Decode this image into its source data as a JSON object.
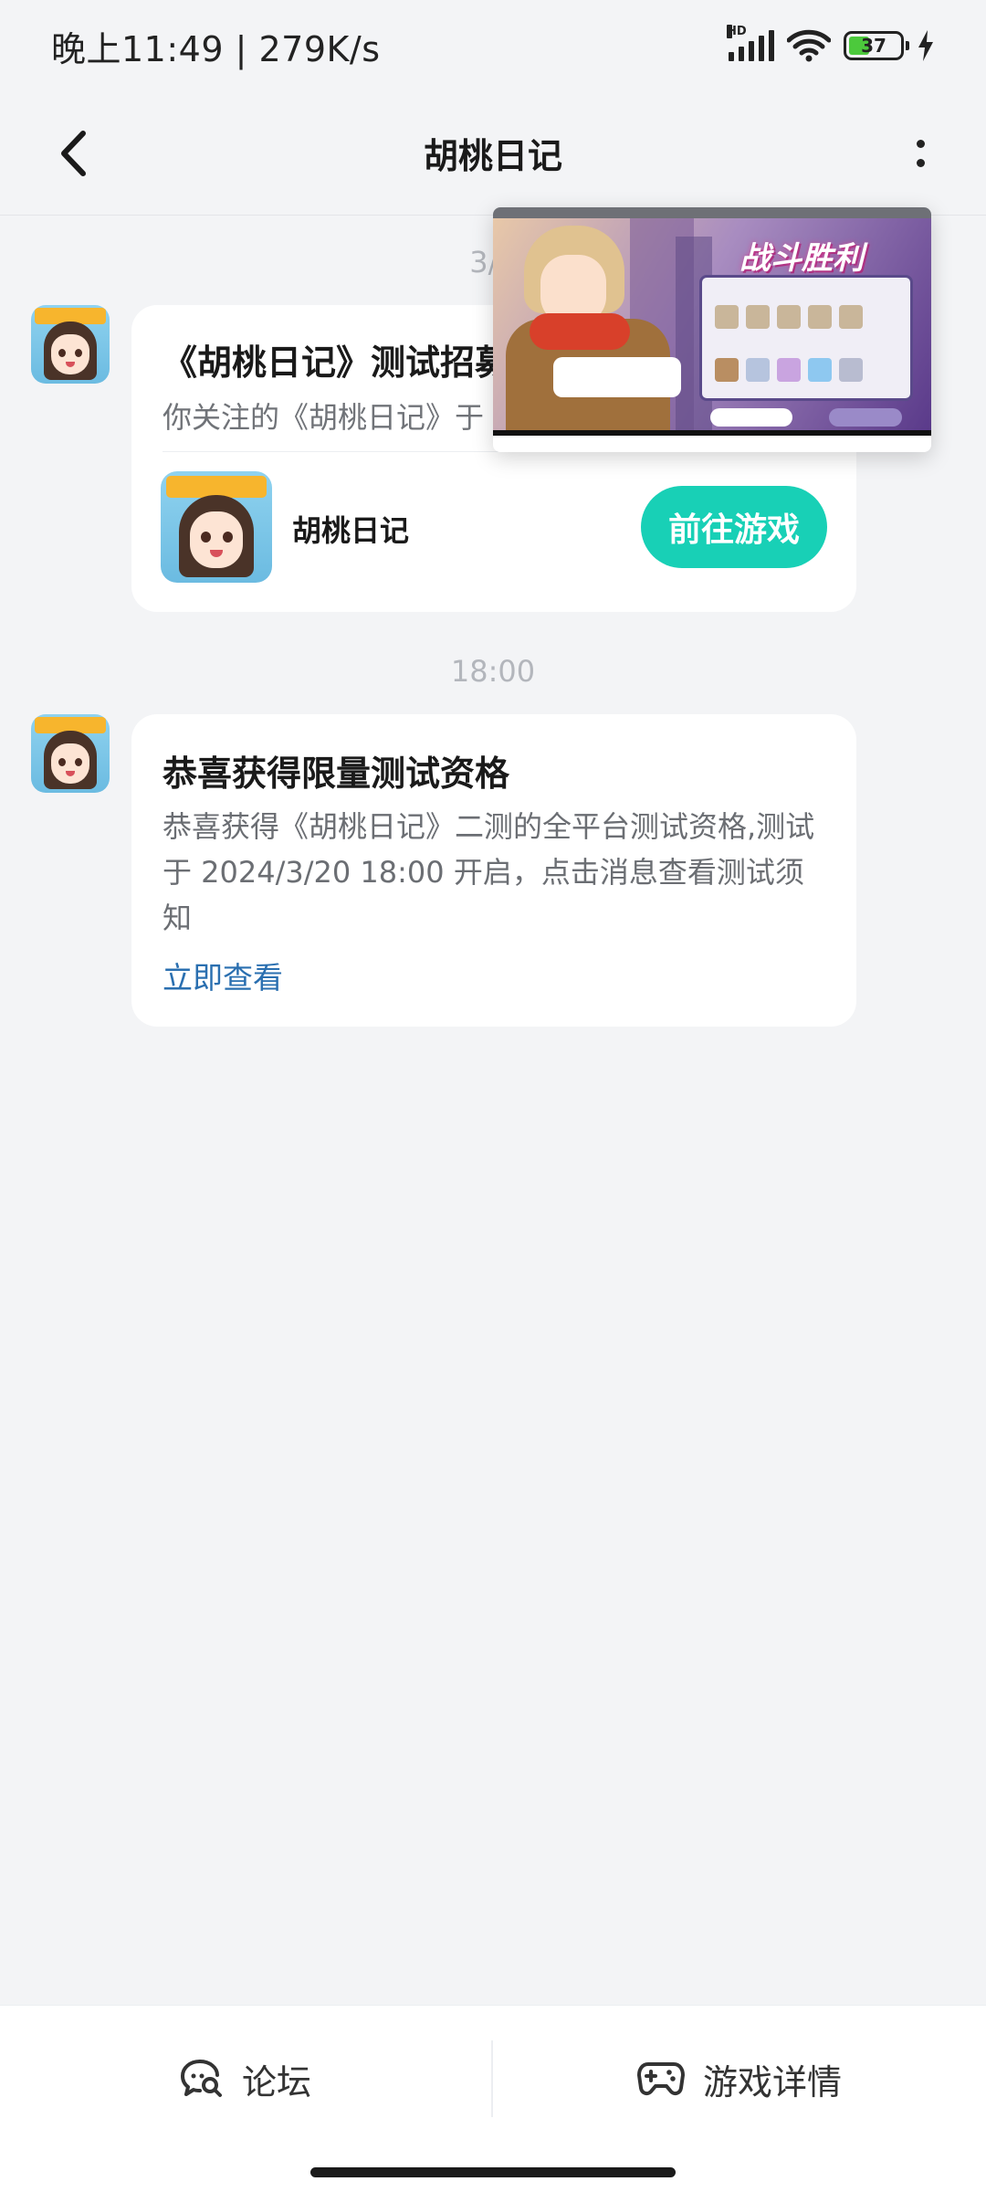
{
  "status_bar": {
    "time_speed": "晚上11:49 | 279K/s",
    "network": "HD",
    "battery": "37"
  },
  "header": {
    "title": "胡桃日记",
    "back_icon": "chevron-left-icon",
    "more_icon": "more-vertical-icon"
  },
  "messages": [
    {
      "time": "3/8",
      "title": "《胡桃日记》测试招募",
      "subtitle": "你关注的《胡桃日记》于",
      "game_name": "胡桃日记",
      "action_label": "前往游戏"
    },
    {
      "time": "18:00",
      "title": "恭喜获得限量测试资格",
      "body": "恭喜获得《胡桃日记》二测的全平台测试资格,测试于 2024/3/20 18:00 开启，点击消息查看测试须知",
      "link": "立即查看"
    }
  ],
  "floating_video": {
    "banner_text": "战斗胜利"
  },
  "bottom_nav": {
    "forum_label": "论坛",
    "forum_icon": "chat-search-icon",
    "details_label": "游戏详情",
    "details_icon": "gamepad-icon"
  },
  "colors": {
    "accent": "#18d0b6",
    "link": "#2a6fb0",
    "background": "#f3f4f6"
  }
}
